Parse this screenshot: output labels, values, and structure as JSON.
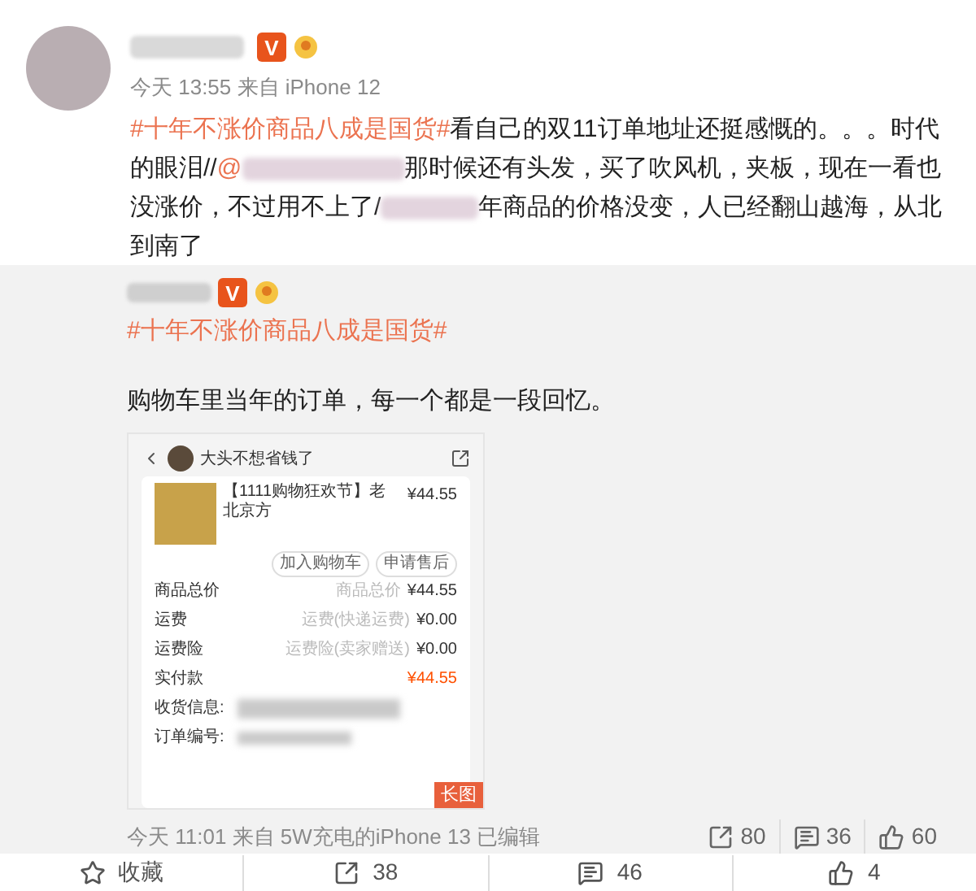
{
  "post": {
    "verified_badge": "V",
    "meta": "今天 13:55 来自 iPhone 12",
    "text": [
      {
        "kind": "topic",
        "text": "#十年不涨价商品八成是国货#"
      },
      {
        "kind": "text",
        "text": "看自己的双11订单地址还挺感慨的。。。时代的眼泪//"
      },
      {
        "kind": "hidden",
        "text": "@"
      },
      {
        "kind": "text",
        "text": "那时候还有头发，买了吹风机，夹板，现在一看也没涨价，不过用不上了/"
      },
      {
        "kind": "hidden"
      },
      {
        "kind": "text",
        "text": "年商品的价格没变，人已经翻山越海，从北到南了"
      }
    ]
  },
  "repost": {
    "verified_badge": "V",
    "topic": "#十年不涨价商品八成是国货#",
    "text": "购物车里当年的订单，每一个都是一段回忆。",
    "screenshot": {
      "shop": "大头不想省钱了",
      "product": "【1111购物狂欢节】老北京方",
      "price": "¥44.55",
      "actions": [
        "加入购物车",
        "申请售后"
      ],
      "rows": [
        {
          "label": "商品总价",
          "note": "商品总价",
          "value": "¥44.55",
          "highlight": false
        },
        {
          "label": "运费",
          "note": "运费(快递运费)",
          "value": "¥0.00",
          "highlight": false
        },
        {
          "label": "运费险",
          "note": "运费险(卖家赠送)",
          "value": "¥0.00",
          "highlight": false
        },
        {
          "label": "实付款",
          "value": "¥44.55",
          "highlight": true
        }
      ],
      "address_label": "收货信息:",
      "order_label": "订单编号:",
      "long_image_tag": "长图"
    },
    "meta": "今天 11:01 来自 5W充电的iPhone 13  已编辑",
    "stats": [
      {
        "kind": "share",
        "count": "80"
      },
      {
        "kind": "comment",
        "count": "36"
      },
      {
        "kind": "like",
        "count": "60"
      }
    ]
  },
  "actions": [
    {
      "kind": "favorite",
      "label": "收藏"
    },
    {
      "kind": "share",
      "label": "38"
    },
    {
      "kind": "comment",
      "label": "46"
    },
    {
      "kind": "like",
      "label": "4"
    }
  ]
}
